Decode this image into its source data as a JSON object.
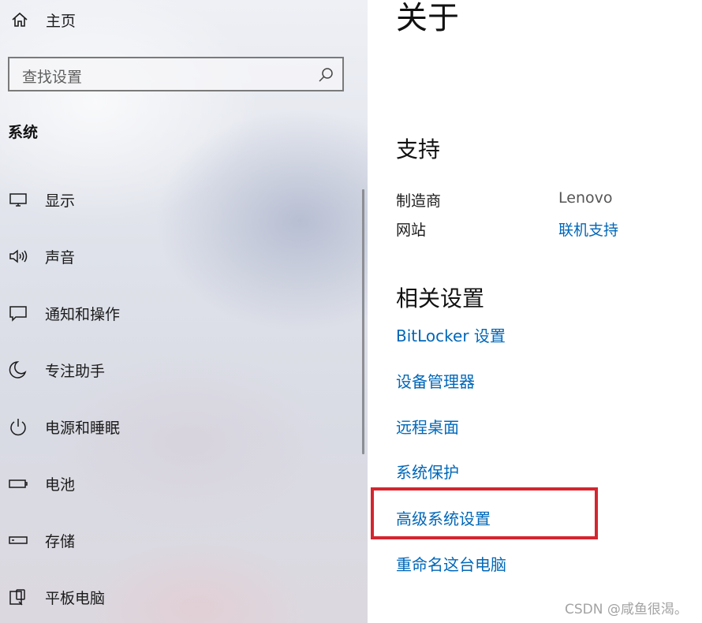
{
  "sidebar": {
    "home_label": "主页",
    "search_placeholder": "查找设置",
    "section_title": "系统",
    "items": [
      {
        "label": "显示",
        "icon": "monitor-icon"
      },
      {
        "label": "声音",
        "icon": "speaker-icon"
      },
      {
        "label": "通知和操作",
        "icon": "notification-icon"
      },
      {
        "label": "专注助手",
        "icon": "moon-icon"
      },
      {
        "label": "电源和睡眠",
        "icon": "power-icon"
      },
      {
        "label": "电池",
        "icon": "battery-icon"
      },
      {
        "label": "存储",
        "icon": "storage-icon"
      },
      {
        "label": "平板电脑",
        "icon": "tablet-icon"
      }
    ]
  },
  "main": {
    "title": "关于",
    "support": {
      "heading": "支持",
      "rows": [
        {
          "label": "制造商",
          "value": "Lenovo"
        },
        {
          "label": "网站",
          "value": "联机支持"
        }
      ]
    },
    "related": {
      "heading": "相关设置",
      "links": [
        "BitLocker 设置",
        "设备管理器",
        "远程桌面",
        "系统保护",
        "高级系统设置",
        "重命名这台电脑"
      ]
    }
  },
  "watermark": "CSDN @咸鱼很渴。",
  "colors": {
    "link": "#0067b8",
    "highlight_border": "#d4262f"
  }
}
